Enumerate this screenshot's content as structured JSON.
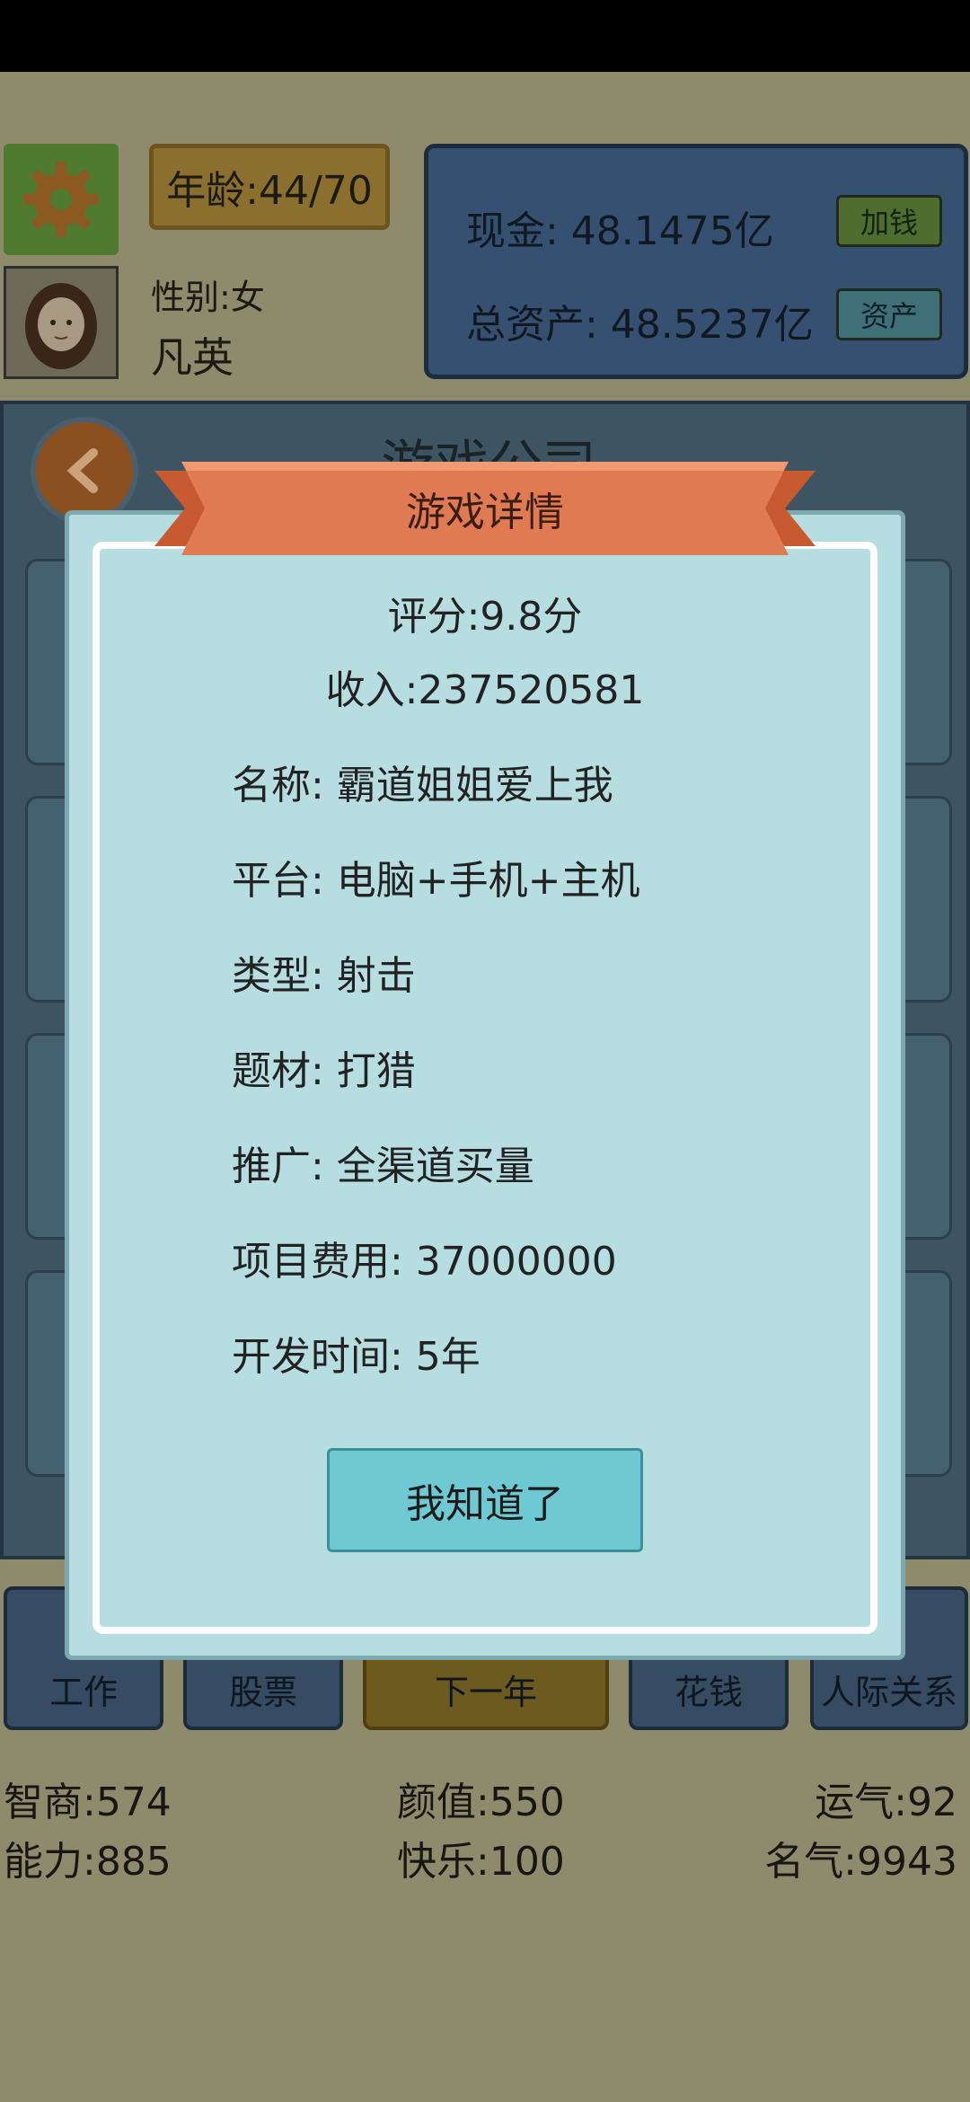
{
  "header": {
    "age": "年龄:44/70",
    "gender": "性别:女",
    "name": "凡英",
    "cash": "现金: 48.1475亿",
    "total_assets": "总资产: 48.5237亿",
    "add_money_label": "加钱",
    "assets_label": "资产"
  },
  "company": {
    "title": "游戏公司"
  },
  "modal": {
    "title": "游戏详情",
    "score": "评分:9.8分",
    "income": "收入:237520581",
    "details": [
      "名称: 霸道姐姐爱上我",
      "平台: 电脑+手机+主机",
      "类型: 射击",
      "题材: 打猎",
      "推广: 全渠道买量",
      "项目费用:  37000000",
      "开发时间:  5年"
    ],
    "confirm_label": "我知道了"
  },
  "tabs": [
    "工作",
    "股票",
    "下一年",
    "花钱",
    "人际关系"
  ],
  "stats": {
    "iq": "智商:574",
    "looks": "颜值:550",
    "luck": "运气:92",
    "ability": "能力:885",
    "happiness": "快乐:100",
    "fame": "名气:9943"
  }
}
